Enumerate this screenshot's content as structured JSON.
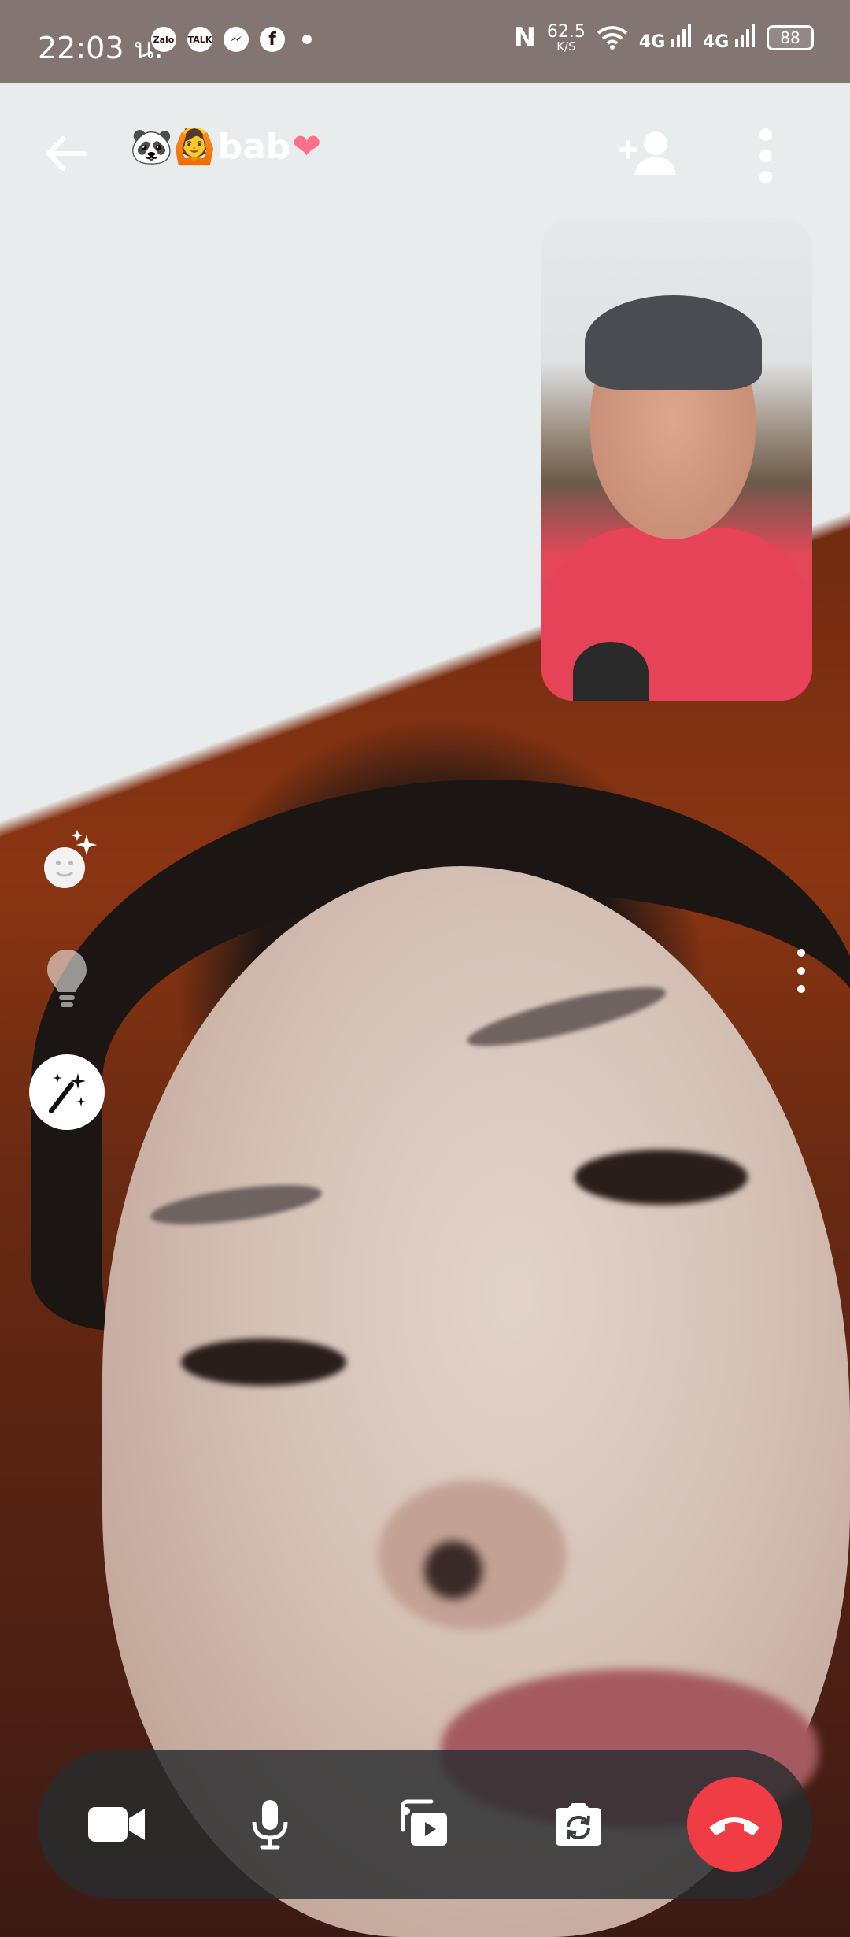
{
  "status_bar": {
    "time": "22:03 น.",
    "apps": [
      "Zalo",
      "TALK"
    ],
    "network_speed_value": "62.5",
    "network_speed_unit": "K/S",
    "signal_1": "4G",
    "signal_2": "4G",
    "battery": "88"
  },
  "call": {
    "title_emojis": "🐼🙆",
    "title_name": "bab",
    "title_heart": "❤"
  },
  "icons": {
    "back": "arrow-left-icon",
    "add_person": "add-person-icon",
    "more": "more-vertical-icon",
    "face_effects": "face-sparkle-icon",
    "lighting": "lightbulb-icon",
    "wand": "magic-wand-icon",
    "camera": "video-camera-icon",
    "mic": "microphone-icon",
    "share": "share-media-icon",
    "flip": "flip-camera-icon",
    "end": "end-call-icon"
  },
  "colors": {
    "end_call": "#f03c45",
    "control_bar": "#282c2e"
  }
}
